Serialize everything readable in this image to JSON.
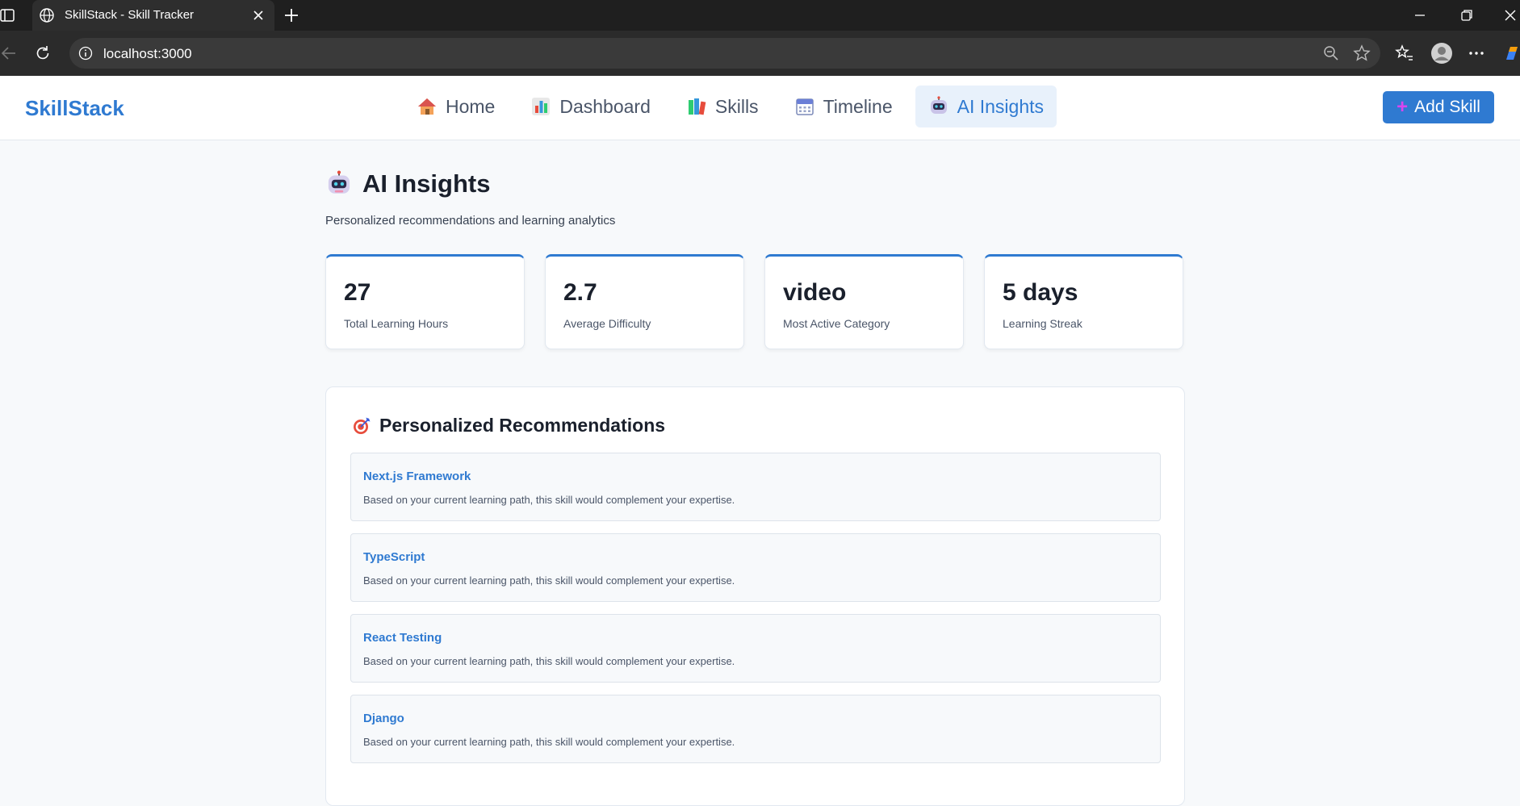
{
  "browser": {
    "tab_title": "SkillStack - Skill Tracker",
    "url": "localhost:3000"
  },
  "app": {
    "logo": "SkillStack",
    "nav": [
      {
        "icon": "house-icon",
        "label": "Home"
      },
      {
        "icon": "bar-chart-icon",
        "label": "Dashboard"
      },
      {
        "icon": "books-icon",
        "label": "Skills"
      },
      {
        "icon": "calendar-icon",
        "label": "Timeline"
      },
      {
        "icon": "robot-icon",
        "label": "AI Insights",
        "active": true
      }
    ],
    "add_skill_label": "Add Skill",
    "accent_color": "#2f7ad1"
  },
  "page": {
    "title": "AI Insights",
    "subtitle": "Personalized recommendations and learning analytics"
  },
  "stats": [
    {
      "value": "27",
      "label": "Total Learning Hours"
    },
    {
      "value": "2.7",
      "label": "Average Difficulty"
    },
    {
      "value": "video",
      "label": "Most Active Category"
    },
    {
      "value": "5 days",
      "label": "Learning Streak"
    }
  ],
  "recommendations": {
    "title": "Personalized Recommendations",
    "items": [
      {
        "name": "Next.js Framework",
        "desc": "Based on your current learning path, this skill would complement your expertise."
      },
      {
        "name": "TypeScript",
        "desc": "Based on your current learning path, this skill would complement your expertise."
      },
      {
        "name": "React Testing",
        "desc": "Based on your current learning path, this skill would complement your expertise."
      },
      {
        "name": "Django",
        "desc": "Based on your current learning path, this skill would complement your expertise."
      }
    ]
  }
}
